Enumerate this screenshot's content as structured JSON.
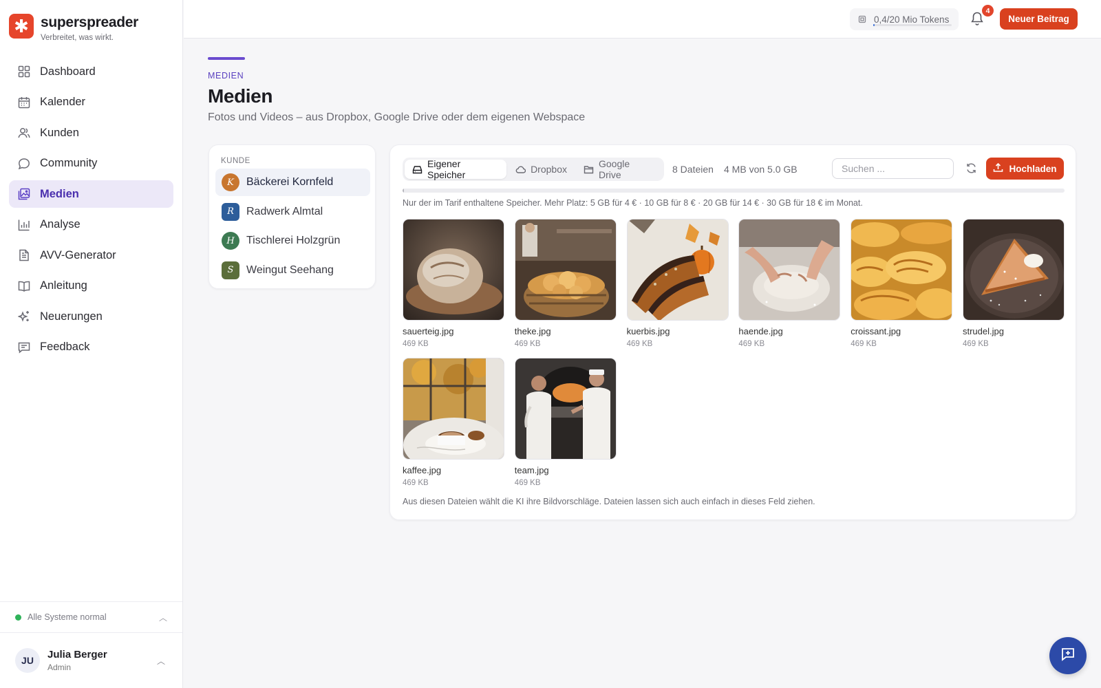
{
  "brand": {
    "name": "superspreader",
    "tagline": "Verbreitet, was wirkt."
  },
  "sidebar": {
    "items": [
      {
        "label": "Dashboard",
        "icon": "grid-icon"
      },
      {
        "label": "Kalender",
        "icon": "calendar-icon"
      },
      {
        "label": "Kunden",
        "icon": "users-icon"
      },
      {
        "label": "Community",
        "icon": "chat-bubble-icon"
      },
      {
        "label": "Medien",
        "icon": "image-icon",
        "active": true
      },
      {
        "label": "Analyse",
        "icon": "bar-chart-icon"
      },
      {
        "label": "AVV-Generator",
        "icon": "document-icon"
      },
      {
        "label": "Anleitung",
        "icon": "book-icon"
      },
      {
        "label": "Neuerungen",
        "icon": "sparkle-icon"
      },
      {
        "label": "Feedback",
        "icon": "message-square-icon"
      }
    ],
    "status": "Alle Systeme normal",
    "user": {
      "initials": "JU",
      "name": "Julia Berger",
      "role": "Admin"
    }
  },
  "topbar": {
    "tokens_text": "0,4/20 Mio Tokens",
    "tokens_used_fraction": 0.02,
    "notifications": "4",
    "new_post_label": "Neuer Beitrag"
  },
  "header": {
    "eyebrow": "MEDIEN",
    "title": "Medien",
    "subtitle": "Fotos und Videos – aus Dropbox, Google Drive oder dem eigenen Webspace"
  },
  "clients": {
    "label": "KUNDE",
    "items": [
      {
        "initial": "K",
        "name": "Bäckerei Kornfeld",
        "color": "#c8762f",
        "active": true
      },
      {
        "initial": "R",
        "name": "Radwerk Almtal",
        "color": "#2d5d9a"
      },
      {
        "initial": "H",
        "name": "Tischlerei Holzgrün",
        "color": "#3d7a52"
      },
      {
        "initial": "S",
        "name": "Weingut Seehang",
        "color": "#5b6e3a"
      }
    ]
  },
  "media": {
    "tabs": [
      {
        "label": "Eigener Speicher",
        "icon": "hard-drive-icon",
        "active": true
      },
      {
        "label": "Dropbox",
        "icon": "cloud-icon"
      },
      {
        "label": "Google Drive",
        "icon": "folder-icon"
      }
    ],
    "file_count": "8 Dateien",
    "storage": "4 MB von 5.0 GB",
    "storage_used_fraction": 0.001,
    "search_placeholder": "Suchen ...",
    "upload_label": "Hochladen",
    "storage_note": "Nur der im Tarif enthaltene Speicher. Mehr Platz: 5 GB für 4 € · 10 GB für 8 € · 20 GB für 14 € · 30 GB für 18 € im Monat.",
    "files": [
      {
        "name": "sauerteig.jpg",
        "size": "469 KB"
      },
      {
        "name": "theke.jpg",
        "size": "469 KB"
      },
      {
        "name": "kuerbis.jpg",
        "size": "469 KB"
      },
      {
        "name": "haende.jpg",
        "size": "469 KB"
      },
      {
        "name": "croissant.jpg",
        "size": "469 KB"
      },
      {
        "name": "strudel.jpg",
        "size": "469 KB"
      },
      {
        "name": "kaffee.jpg",
        "size": "469 KB"
      },
      {
        "name": "team.jpg",
        "size": "469 KB"
      }
    ],
    "footnote": "Aus diesen Dateien wählt die KI ihre Bildvorschläge. Dateien lassen sich auch einfach in dieses Feld ziehen."
  },
  "colors": {
    "accent": "#6a4bcf",
    "primary_button": "#d9411f",
    "fab": "#2c4aa8"
  }
}
